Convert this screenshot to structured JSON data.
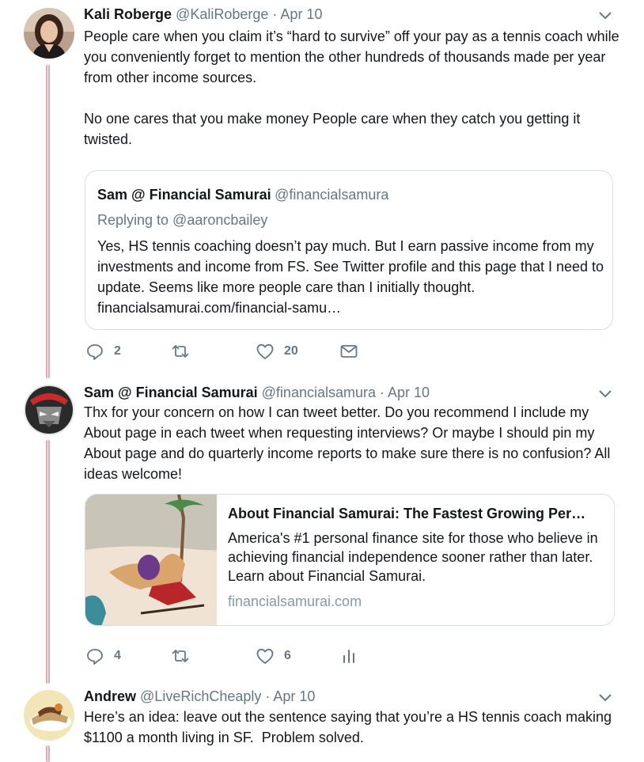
{
  "tweets": [
    {
      "name": "Kali Roberge",
      "handle": "@KaliRoberge",
      "separator": "·",
      "time": "Apr 10",
      "text": "People care when you claim it’s “hard to survive” off your pay as a tennis coach while you conveniently forget to mention the other hundreds of thousands made per year from other income sources.\n\nNo one cares that you make money People care when they catch you getting it twisted.",
      "quote": {
        "name": "Sam @ Financial Samurai",
        "handle": "@financialsamura",
        "replying": "Replying to @aaroncbailey",
        "text": "Yes, HS tennis coaching doesn’t pay much. But I earn passive income from my investments and income from FS.  See Twitter profile and this page that I need to update. Seems like more people care than I initially thought. financialsamurai.com/financial-samu…"
      },
      "replies": "2",
      "retweets": "",
      "likes": "20"
    },
    {
      "name": "Sam @ Financial Samurai",
      "handle": "@financialsamura",
      "separator": "·",
      "time": "Apr 10",
      "text": "Thx for your concern on how I can tweet better. Do you recommend I include my About page in each tweet when requesting interviews? Or maybe I should pin my About page and do quarterly income reports to make sure there is no confusion? All ideas welcome!",
      "card": {
        "title": "About Financial Samurai: The Fastest Growing Per…",
        "description": "America's #1 personal finance site for those who believe in achieving financial independence sooner rather than later. Learn about Financial Samurai.",
        "domain": "financialsamurai.com"
      },
      "replies": "4",
      "retweets": "",
      "likes": "6"
    },
    {
      "name": "Andrew",
      "handle": "@LiveRichCheaply",
      "separator": "·",
      "time": "Apr 10",
      "text": "Here’s an idea: leave out the sentence saying that you’re a HS tennis coach making $1100 a month living in SF.  Problem solved."
    }
  ],
  "icons": {
    "reply": "reply-icon",
    "retweet": "retweet-icon",
    "like": "heart-icon",
    "dm": "envelope-icon",
    "analytics": "analytics-icon",
    "caret": "chevron-down-icon"
  },
  "colors": {
    "thread_line": "#e7a7ab",
    "secondary_text": "#657786",
    "border": "#d8dfe4"
  }
}
